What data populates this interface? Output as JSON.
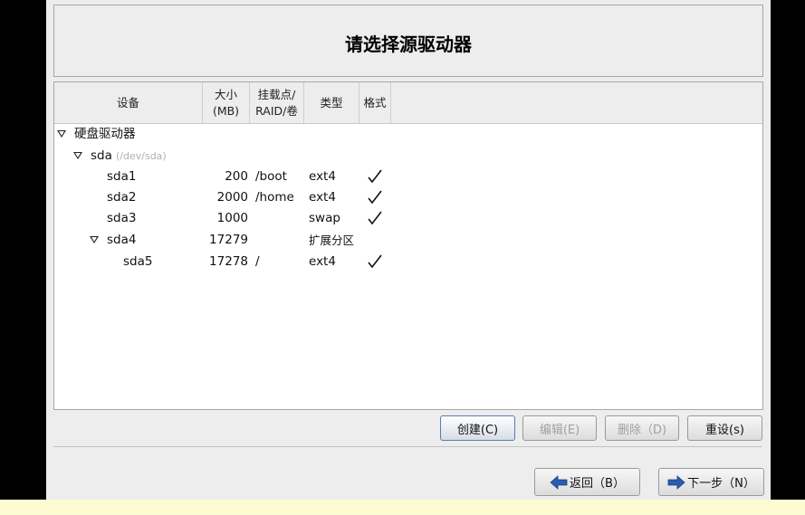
{
  "title": "请选择源驱动器",
  "columns": {
    "device": "设备",
    "size": "大小\n(MB)",
    "mount": "挂载点/\nRAID/卷",
    "type": "类型",
    "format": "格式"
  },
  "tree": {
    "root_label": "硬盘驱动器",
    "disk_name": "sda",
    "disk_path": "(/dev/sda)",
    "partitions": [
      {
        "name": "sda1",
        "size": "200",
        "mount": "/boot",
        "type": "ext4",
        "format": true
      },
      {
        "name": "sda2",
        "size": "2000",
        "mount": "/home",
        "type": "ext4",
        "format": true
      },
      {
        "name": "sda3",
        "size": "1000",
        "mount": "",
        "type": "swap",
        "format": true
      },
      {
        "name": "sda4",
        "size": "17279",
        "mount": "",
        "type": "扩展分区",
        "format": false
      },
      {
        "name": "sda5",
        "size": "17278",
        "mount": "/",
        "type": "ext4",
        "format": true
      }
    ]
  },
  "actions": {
    "create": "创建(C)",
    "edit": "编辑(E)",
    "delete": "删除（D)",
    "reset": "重设(s)"
  },
  "nav": {
    "back": "返回（B）",
    "next": "下一步（N）"
  },
  "colors": {
    "nav_arrow": "#2a5db0",
    "window_bg": "#ededed"
  }
}
